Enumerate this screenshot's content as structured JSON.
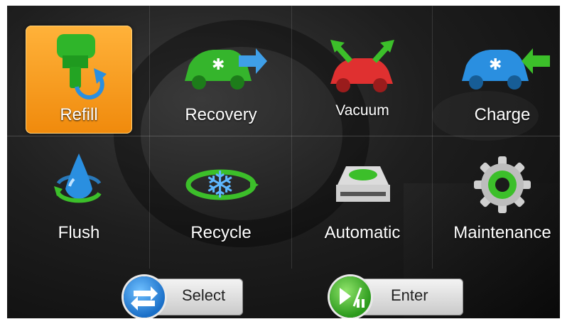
{
  "menu": {
    "tiles": [
      {
        "label": "Refill",
        "icon": "refill-icon",
        "selected": true
      },
      {
        "label": "Recovery",
        "icon": "recovery-car-icon"
      },
      {
        "label": "Vacuum",
        "icon": "vacuum-car-icon"
      },
      {
        "label": "Charge",
        "icon": "charge-car-icon"
      },
      {
        "label": "Flush",
        "icon": "flush-drop-icon"
      },
      {
        "label": "Recycle",
        "icon": "recycle-snowflake-icon"
      },
      {
        "label": "Automatic",
        "icon": "automatic-device-icon"
      },
      {
        "label": "Maintenance",
        "icon": "maintenance-gear-icon"
      }
    ]
  },
  "controls": {
    "select_label": "Select",
    "select_icon": "swap-arrows-icon",
    "enter_label": "Enter",
    "enter_icon": "play-pause-icon"
  },
  "colors": {
    "selected_tile": "#f29a1a",
    "green": "#3cbf2a",
    "blue": "#2a8fe0",
    "red": "#e03030"
  }
}
